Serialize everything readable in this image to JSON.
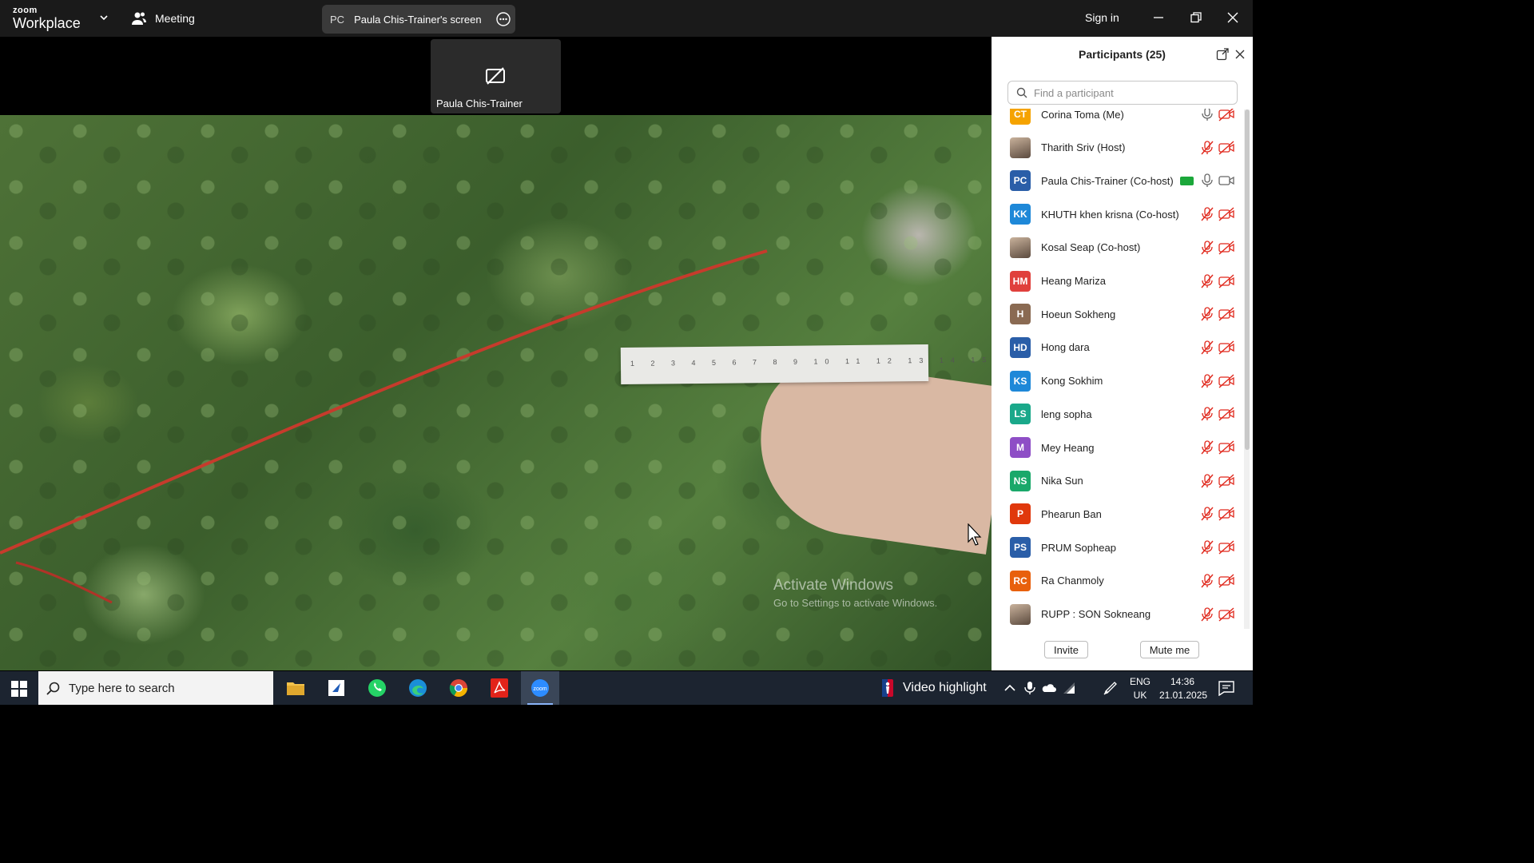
{
  "app": {
    "logo_small": "zoom",
    "logo_big": "Workplace",
    "meeting_label": "Meeting",
    "screen_initials": "PC",
    "screen_label": "Paula Chis-Trainer's screen",
    "sign_in": "Sign in"
  },
  "video": {
    "thumbnail_name": "Paula Chis-Trainer",
    "ruler_numbers": "1 2 3 4 5 6 7 8 9 10 11 12 13 14 15 16 17 18 19 20",
    "watermark_line1": "Activate Windows",
    "watermark_line2": "Go to Settings to activate Windows."
  },
  "participants": {
    "title": "Participants (25)",
    "search_placeholder": "Find a participant",
    "invite_label": "Invite",
    "mute_me_label": "Mute me",
    "list": [
      {
        "initials": "CT",
        "name": "Corina Toma (Me)",
        "color": "#f5a300",
        "photo": false,
        "sharing": false,
        "mic": "on",
        "cam": "off"
      },
      {
        "initials": "",
        "name": "Tharith Sriv (Host)",
        "color": "#7a6a5a",
        "photo": true,
        "sharing": false,
        "mic": "off",
        "cam": "off"
      },
      {
        "initials": "PC",
        "name": "Paula Chis-Trainer (Co-host)",
        "color": "#2a5ea8",
        "photo": false,
        "sharing": true,
        "mic": "on",
        "cam": "on"
      },
      {
        "initials": "KK",
        "name": "KHUTH khen krisna (Co-host)",
        "color": "#1e88d8",
        "photo": false,
        "sharing": false,
        "mic": "off",
        "cam": "off"
      },
      {
        "initials": "",
        "name": "Kosal Seap (Co-host)",
        "color": "#7a6a5a",
        "photo": true,
        "sharing": false,
        "mic": "off",
        "cam": "off"
      },
      {
        "initials": "HM",
        "name": "Heang Mariza",
        "color": "#e0403c",
        "photo": false,
        "sharing": false,
        "mic": "off",
        "cam": "off"
      },
      {
        "initials": "H",
        "name": "Hoeun Sokheng",
        "color": "#8a6a52",
        "photo": false,
        "sharing": false,
        "mic": "off",
        "cam": "off"
      },
      {
        "initials": "HD",
        "name": "Hong dara",
        "color": "#2a5ea8",
        "photo": false,
        "sharing": false,
        "mic": "off",
        "cam": "off"
      },
      {
        "initials": "KS",
        "name": "Kong Sokhim",
        "color": "#1e88d8",
        "photo": false,
        "sharing": false,
        "mic": "off",
        "cam": "off"
      },
      {
        "initials": "LS",
        "name": "leng sopha",
        "color": "#1aa88a",
        "photo": false,
        "sharing": false,
        "mic": "off",
        "cam": "off"
      },
      {
        "initials": "M",
        "name": "Mey Heang",
        "color": "#8e4ec6",
        "photo": false,
        "sharing": false,
        "mic": "off",
        "cam": "off"
      },
      {
        "initials": "NS",
        "name": "Nika Sun",
        "color": "#1aa86a",
        "photo": false,
        "sharing": false,
        "mic": "off",
        "cam": "off"
      },
      {
        "initials": "P",
        "name": "Phearun Ban",
        "color": "#e0380c",
        "photo": false,
        "sharing": false,
        "mic": "off",
        "cam": "off"
      },
      {
        "initials": "PS",
        "name": "PRUM Sopheap",
        "color": "#2a5ea8",
        "photo": false,
        "sharing": false,
        "mic": "off",
        "cam": "off"
      },
      {
        "initials": "RC",
        "name": "Ra Chanmoly",
        "color": "#e8600c",
        "photo": false,
        "sharing": false,
        "mic": "off",
        "cam": "off"
      },
      {
        "initials": "",
        "name": "RUPP : SON Sokneang",
        "color": "#7a6a5a",
        "photo": true,
        "sharing": false,
        "mic": "off",
        "cam": "off"
      }
    ]
  },
  "taskbar": {
    "search_placeholder": "Type here to search",
    "video_highlight": "Video highlight",
    "lang_top": "ENG",
    "lang_bottom": "UK",
    "time": "14:36",
    "date": "21.01.2025"
  },
  "colors": {
    "share_green": "#1ba73a",
    "mic_muted_red": "#e0281c"
  }
}
